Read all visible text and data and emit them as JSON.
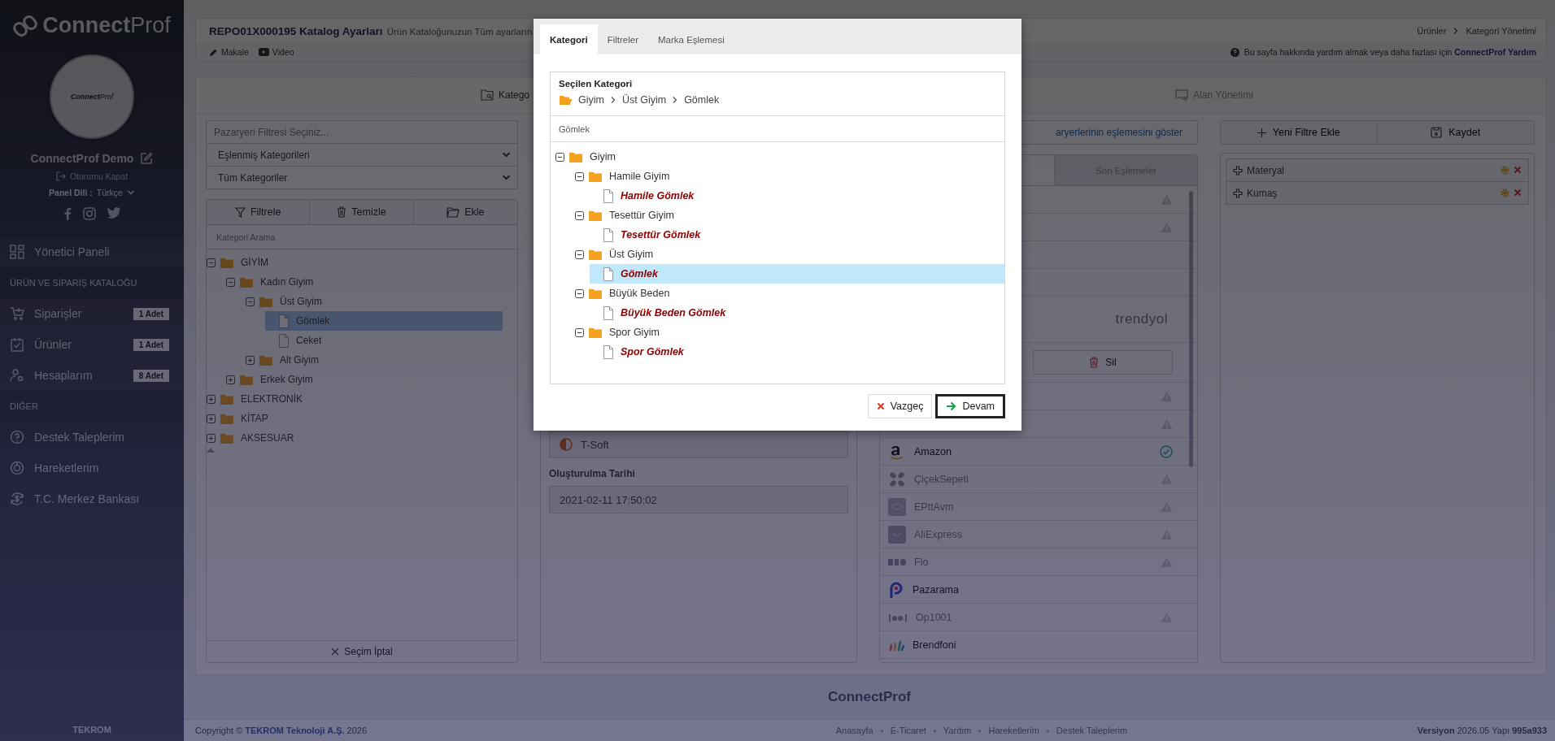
{
  "sidebar": {
    "brand": {
      "main": "Connect",
      "accent": "Prof"
    },
    "avatar_logo": {
      "main": "Connect",
      "accent": "Prof"
    },
    "user_name": "ConnectProf Demo",
    "logout": "Oturumu Kapat",
    "language_label": "Panel Dili :",
    "language": "Türkçe",
    "nav": [
      {
        "kind": "item",
        "label": "Yönetici Paneli"
      },
      {
        "kind": "section",
        "label": "ÜRÜN VE SİPARİŞ KATALOĞU"
      },
      {
        "kind": "item",
        "label": "Siparişler",
        "badge": "1 Adet"
      },
      {
        "kind": "item",
        "label": "Ürünler",
        "badge": "1 Adet"
      },
      {
        "kind": "item",
        "label": "Hesaplarım",
        "badge": "8 Adet"
      },
      {
        "kind": "section",
        "label": "DİĞER"
      },
      {
        "kind": "item",
        "label": "Destek Taleplerim"
      },
      {
        "kind": "item",
        "label": "Hareketlerim"
      },
      {
        "kind": "item",
        "label": "T.C. Merkez Bankası"
      }
    ],
    "footer": "TEKROM"
  },
  "header": {
    "title": "REPO01X000195 Katalog Ayarları",
    "subtitle": "Ürün Kataloğunuzun Tüm ayarların",
    "breadcrumb": [
      "Ürünler",
      "Kategori Yönetimi"
    ],
    "links": [
      "Makale",
      "Video"
    ],
    "help": "Bu sayfa hakkında yardım almak veya daha fazlası için **ConnectProf Yardım**"
  },
  "main_tabs": [
    {
      "label": "Katego",
      "selected": true
    },
    {
      "label": "Alan Yönetimi",
      "selected": false
    }
  ],
  "left": {
    "marketplace_placeholder": "Pazaryeri Filtresi Seçiniz...",
    "selects": [
      "Eşlenmiş Kategorileri",
      "Tüm Kategoriler"
    ],
    "toolbar": [
      "Filtrele",
      "Temizle",
      "Ekle"
    ],
    "search_placeholder": "Kategori Arama",
    "tree": [
      {
        "kind": "folder",
        "label": "GİYİM",
        "expanded": true,
        "selected": false,
        "children": [
          {
            "kind": "folder",
            "label": "Kadın Giyim",
            "expanded": true,
            "selected": false,
            "children": [
              {
                "kind": "folder",
                "label": "Üst Giyim",
                "expanded": true,
                "selected": false,
                "children": [
                  {
                    "kind": "file",
                    "label": "Gömlek",
                    "selected": true,
                    "highlighted": false
                  },
                  {
                    "kind": "file",
                    "label": "Ceket",
                    "selected": false,
                    "highlighted": false
                  }
                ]
              },
              {
                "kind": "folder",
                "label": "Alt Giyim",
                "expanded": false,
                "selected": false
              }
            ]
          },
          {
            "kind": "folder",
            "label": "Erkek Giyim",
            "expanded": false,
            "selected": false
          }
        ]
      },
      {
        "kind": "folder",
        "label": "ELEKTRONİK",
        "expanded": false,
        "selected": false
      },
      {
        "kind": "folder",
        "label": "KİTAP",
        "expanded": false,
        "selected": false
      },
      {
        "kind": "folder",
        "label": "AKSESUAR",
        "expanded": false,
        "selected": false
      }
    ],
    "cancel": "Seçim İptal"
  },
  "middle": {
    "source": "T-Soft",
    "date_label": "Oluşturulma Tarihi",
    "date": "2021-02-11 17:50:02"
  },
  "matching": {
    "link": "aryerlerinin eşlemesini göster",
    "tab": {
      "label": "Son Eşlemeler",
      "selected": false
    },
    "top_rows": [
      {
        "warning": true
      },
      {
        "warning": true
      }
    ],
    "brand_logo": "trendyol",
    "delete": "Sil",
    "markets": [
      {
        "warning": true
      },
      {
        "warning": true
      },
      {
        "name": "Amazon",
        "warning": false,
        "verified": true,
        "enabled": true
      },
      {
        "name": "ÇiçekSepeti",
        "warning": true,
        "enabled": false
      },
      {
        "name": "EPttAvm",
        "warning": true,
        "enabled": false
      },
      {
        "name": "AliExpress",
        "warning": true,
        "enabled": false
      },
      {
        "name": "Flo",
        "warning": true,
        "enabled": false
      },
      {
        "name": "Pazarama",
        "warning": false,
        "verified": false,
        "enabled": true
      },
      {
        "name": "Op1001",
        "warning": true,
        "enabled": false
      },
      {
        "name": "Brendfoni",
        "warning": false,
        "verified": false,
        "enabled": true
      }
    ]
  },
  "right": {
    "buttons": [
      "Yeni Filtre Ekle",
      "Kaydet"
    ],
    "filters": [
      "Materyal",
      "Kumaş"
    ]
  },
  "footer": {
    "brand": "ConnectProf",
    "copyright": "Copyright © **TEKROM Teknoloji A.Ş.** 2026",
    "links": [
      "Anasayfa",
      "E-Ticaret",
      "Yardım",
      "Hareketlerim",
      "Destek Taleplerim"
    ],
    "version": "**Versiyon** 2026.05 Yapı **995a933**"
  },
  "modal": {
    "tabs": [
      {
        "label": "Kategori",
        "selected": true
      },
      {
        "label": "Filtreler",
        "selected": false
      },
      {
        "label": "Marka Eşlemesi",
        "selected": false
      }
    ],
    "selected_label": "Seçilen Kategori",
    "path": [
      "Giyim",
      "Üst Giyim",
      "Gömlek"
    ],
    "search": "Gömlek",
    "tree": [
      {
        "kind": "folder",
        "label": "Giyim",
        "expanded": true,
        "selected": false,
        "children": [
          {
            "kind": "folder",
            "label": "Hamile Giyim",
            "expanded": true,
            "selected": false,
            "children": [
              {
                "kind": "file",
                "label": "Hamile Gömlek",
                "selected": false,
                "highlighted": true
              }
            ]
          },
          {
            "kind": "folder",
            "label": "Tesettür Giyim",
            "expanded": true,
            "selected": false,
            "children": [
              {
                "kind": "file",
                "label": "Tesettür Gömlek",
                "selected": false,
                "highlighted": true
              }
            ]
          },
          {
            "kind": "folder",
            "label": "Üst Giyim",
            "expanded": true,
            "selected": false,
            "children": [
              {
                "kind": "file",
                "label": "Gömlek",
                "selected": true,
                "highlighted": true
              }
            ]
          },
          {
            "kind": "folder",
            "label": "Büyük Beden",
            "expanded": true,
            "selected": false,
            "children": [
              {
                "kind": "file",
                "label": "Büyük Beden Gömlek",
                "selected": false,
                "highlighted": true
              }
            ]
          },
          {
            "kind": "folder",
            "label": "Spor Giyim",
            "expanded": true,
            "selected": false,
            "children": [
              {
                "kind": "file",
                "label": "Spor Gömlek",
                "selected": false,
                "highlighted": true
              }
            ]
          }
        ]
      }
    ],
    "buttons": [
      {
        "kind": "cancel",
        "label": "Vazgeç",
        "focused": false
      },
      {
        "kind": "continue",
        "label": "Devam",
        "focused": true
      }
    ]
  }
}
